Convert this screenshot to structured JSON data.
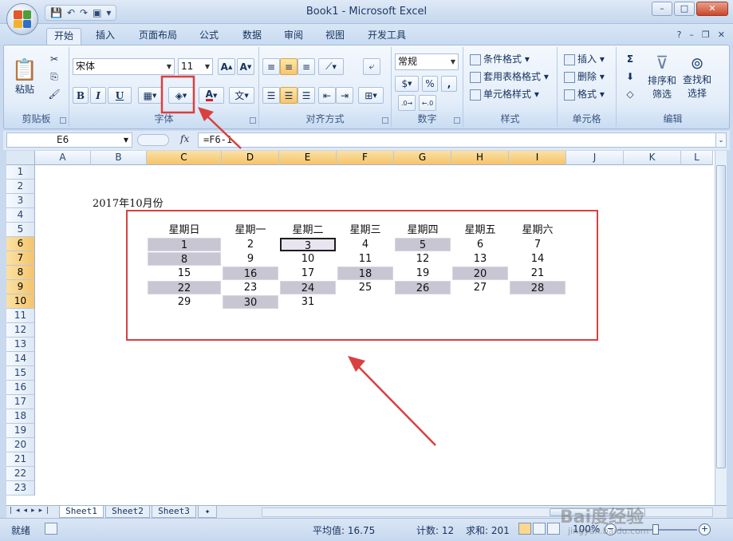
{
  "window": {
    "title": "Book1 - Microsoft Excel"
  },
  "tabs": [
    "开始",
    "插入",
    "页面布局",
    "公式",
    "数据",
    "审阅",
    "视图",
    "开发工具"
  ],
  "ribbon": {
    "clipboard": {
      "paste": "粘贴",
      "label": "剪贴板"
    },
    "font": {
      "name": "宋体",
      "size": "11",
      "bold": "B",
      "italic": "I",
      "underline": "U",
      "font_color_glyph": "A",
      "phonetic_glyph": "文",
      "label": "字体"
    },
    "alignment": {
      "label": "对齐方式"
    },
    "number": {
      "format": "常规",
      "percent": "%",
      "comma": ",",
      "label": "数字"
    },
    "styles": {
      "conditional": "条件格式",
      "table": "套用表格格式",
      "cell": "单元格样式",
      "label": "样式"
    },
    "cells": {
      "insert": "插入",
      "delete": "删除",
      "format": "格式",
      "label": "单元格"
    },
    "editing": {
      "sigma": "Σ",
      "sort": "排序和",
      "sort2": "筛选",
      "find": "查找和",
      "find2": "选择",
      "label": "编辑"
    }
  },
  "formula_bar": {
    "name_box": "E6",
    "fx": "fx",
    "formula": "=F6-1"
  },
  "columns": [
    "A",
    "B",
    "C",
    "D",
    "E",
    "F",
    "G",
    "H",
    "I",
    "J",
    "K",
    "L"
  ],
  "rows": [
    "1",
    "2",
    "3",
    "4",
    "5",
    "6",
    "7",
    "8",
    "9",
    "10",
    "11",
    "12",
    "13",
    "14",
    "15",
    "16",
    "17",
    "18",
    "19",
    "20",
    "21",
    "22",
    "23"
  ],
  "calendar": {
    "title": "2017年10月份",
    "weekdays": [
      "星期日",
      "星期一",
      "星期二",
      "星期三",
      "星期四",
      "星期五",
      "星期六"
    ],
    "weeks": [
      [
        "1",
        "2",
        "3",
        "4",
        "5",
        "6",
        "7"
      ],
      [
        "8",
        "9",
        "10",
        "11",
        "12",
        "13",
        "14"
      ],
      [
        "15",
        "16",
        "17",
        "18",
        "19",
        "20",
        "21"
      ],
      [
        "22",
        "23",
        "24",
        "25",
        "26",
        "27",
        "28"
      ],
      [
        "29",
        "30",
        "31",
        "",
        "",
        "",
        ""
      ]
    ],
    "highlighted": [
      [
        0,
        0
      ],
      [
        0,
        2
      ],
      [
        0,
        4
      ],
      [
        1,
        0
      ],
      [
        2,
        1
      ],
      [
        2,
        3
      ],
      [
        2,
        5
      ],
      [
        3,
        0
      ],
      [
        3,
        2
      ],
      [
        3,
        4
      ],
      [
        3,
        6
      ],
      [
        4,
        1
      ]
    ],
    "active": [
      0,
      2
    ],
    "highlight_color": "#c8c6d2"
  },
  "sheets": [
    "Sheet1",
    "Sheet2",
    "Sheet3"
  ],
  "status": {
    "ready": "就绪",
    "average": "平均值: 16.75",
    "count": "计数: 12",
    "sum": "求和: 201",
    "zoom": "100%"
  },
  "watermark": {
    "main": "Bai度经验",
    "sub": "jingyan.baidu.com"
  },
  "colors": {
    "annotation": "#d9403f",
    "selected_header": "#f5c46b"
  }
}
